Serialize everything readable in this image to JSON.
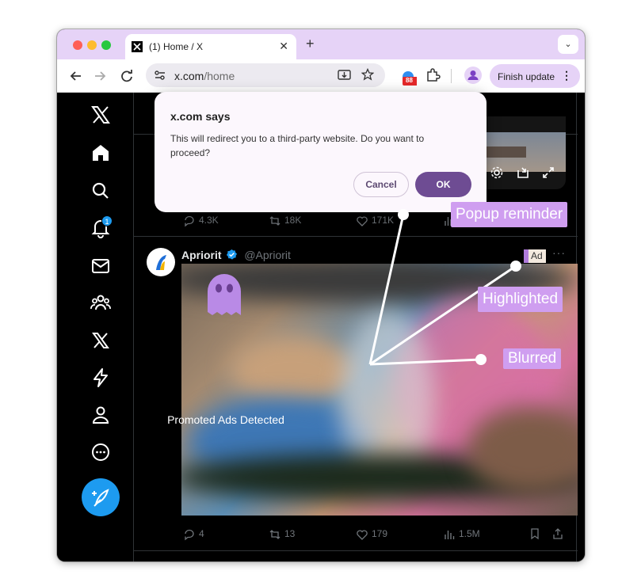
{
  "browser": {
    "tab_title": "(1) Home / X",
    "url_host": "x.com",
    "url_path": "/home",
    "extension_badge": "88",
    "finish_update_label": "Finish update",
    "new_tab_glyph": "+",
    "close_tab_glyph": "✕",
    "tab_menu_glyph": "⌄",
    "menu_glyph": "⋮"
  },
  "dialog": {
    "title": "x.com says",
    "message": "This will redirect you to a third-party website. Do you want to proceed?",
    "cancel_label": "Cancel",
    "ok_label": "OK"
  },
  "prev_tweet": {
    "replies": "4.3K",
    "reposts": "18K",
    "likes": "171K"
  },
  "tweet": {
    "author_name": "Apriorit",
    "author_handle": "@Apriorit",
    "ad_label": "Ad",
    "more_glyph": "···",
    "overlay_text": "Promoted Ads Detected",
    "replies": "4",
    "reposts": "13",
    "likes": "179",
    "views": "1.5M"
  },
  "annotations": {
    "popup": "Popup reminder",
    "highlighted": "Highlighted",
    "blurred": "Blurred"
  },
  "colors": {
    "accent_purple": "#cf9ef0",
    "tab_bar": "#e6d3f7",
    "dialog_ok": "#6e4c93",
    "x_blue": "#1d9bf0",
    "ghost": "#b98ae6"
  },
  "icons": {
    "sidebar": [
      "x-logo-icon",
      "home-icon",
      "search-icon",
      "notifications-icon",
      "messages-icon",
      "communities-icon",
      "premium-icon",
      "verified-orgs-icon",
      "profile-icon",
      "more-icon"
    ],
    "notification_count": "1"
  }
}
